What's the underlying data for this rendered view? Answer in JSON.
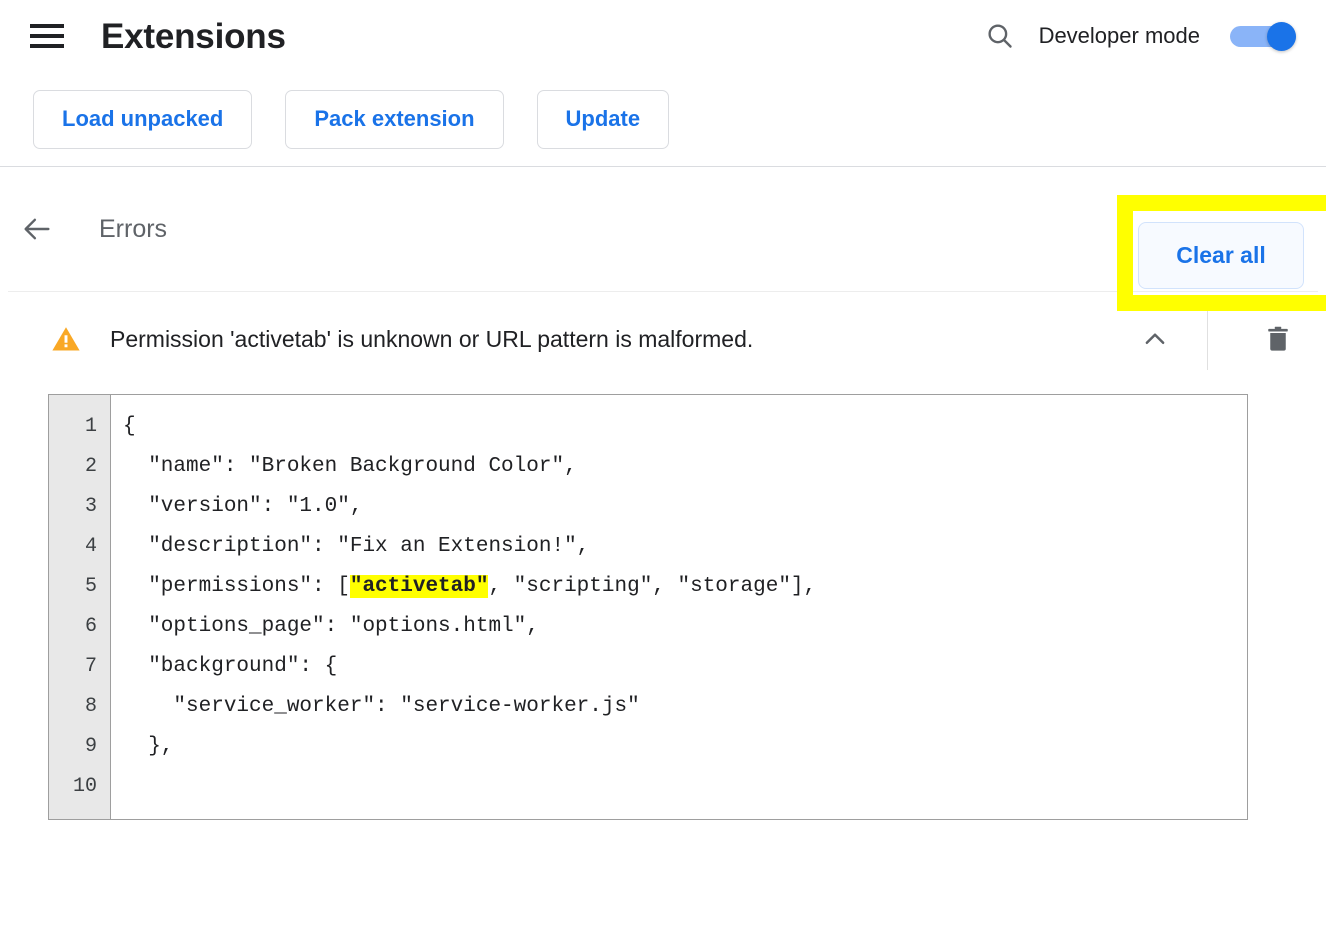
{
  "header": {
    "menu_icon": "hamburger-menu-icon",
    "title": "Extensions",
    "search_icon": "search-icon",
    "developer_mode_label": "Developer mode",
    "developer_mode_on": true,
    "toggle_on_color": "#1a73e8",
    "toggle_track_color": "#8ab4f8"
  },
  "toolbar": {
    "load_unpacked_label": "Load unpacked",
    "pack_extension_label": "Pack extension",
    "update_label": "Update"
  },
  "errors_page": {
    "back_icon": "back-arrow-icon",
    "title": "Errors",
    "clear_all_label": "Clear all",
    "highlight_color": "#ffff00",
    "accent_color": "#1a73e8"
  },
  "error_entry": {
    "severity_icon": "warning-triangle-icon",
    "severity_color": "#f9a825",
    "message": "Permission 'activetab' is unknown or URL pattern is malformed.",
    "collapse_icon": "chevron-up-icon",
    "delete_icon": "trash-icon"
  },
  "code_viewer": {
    "line_numbers": [
      "1",
      "2",
      "3",
      "4",
      "5",
      "6",
      "7",
      "8",
      "9",
      "10"
    ],
    "lines": [
      {
        "pre": "{",
        "hl": "",
        "post": ""
      },
      {
        "pre": "  \"name\": \"Broken Background Color\",",
        "hl": "",
        "post": ""
      },
      {
        "pre": "  \"version\": \"1.0\",",
        "hl": "",
        "post": ""
      },
      {
        "pre": "  \"description\": \"Fix an Extension!\",",
        "hl": "",
        "post": ""
      },
      {
        "pre": "  \"permissions\": [",
        "hl": "\"activetab\"",
        "post": ", \"scripting\", \"storage\"],"
      },
      {
        "pre": "  \"options_page\": \"options.html\",",
        "hl": "",
        "post": ""
      },
      {
        "pre": "  \"background\": {",
        "hl": "",
        "post": ""
      },
      {
        "pre": "    \"service_worker\": \"service-worker.js\"",
        "hl": "",
        "post": ""
      },
      {
        "pre": "  },",
        "hl": "",
        "post": ""
      },
      {
        "pre": "",
        "hl": "",
        "post": ""
      }
    ],
    "highlight_background": "#ffff00"
  }
}
